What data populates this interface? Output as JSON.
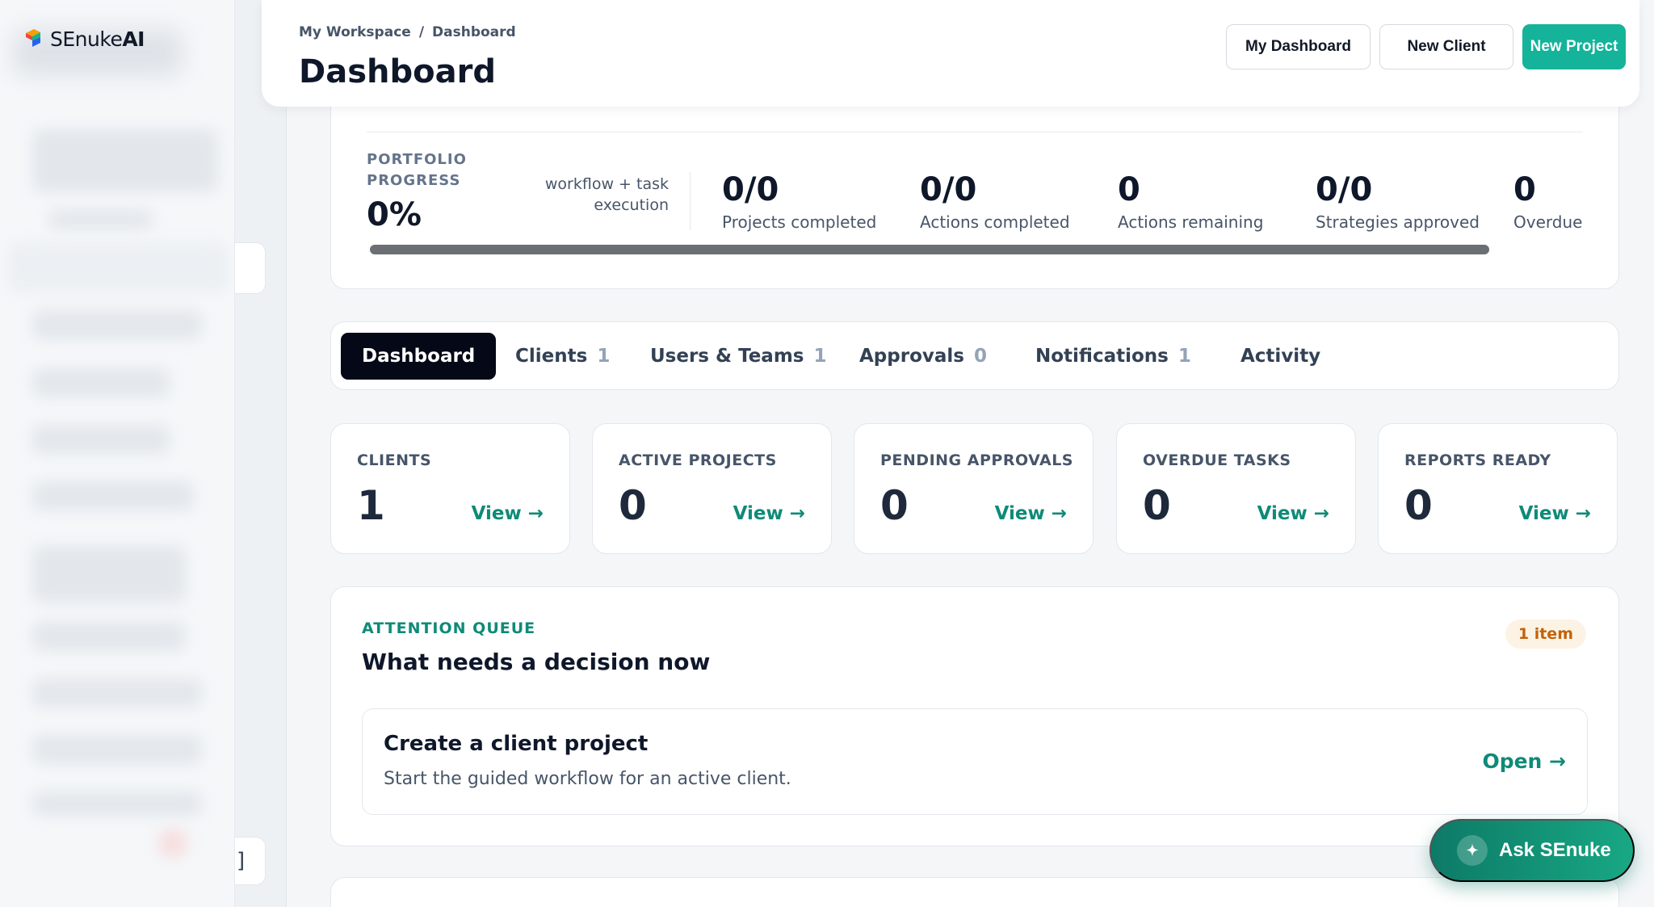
{
  "brand": {
    "name_light": "SEnuke",
    "name_bold": "AI"
  },
  "header": {
    "breadcrumb": [
      "My Workspace",
      "/",
      "Dashboard"
    ],
    "title": "Dashboard",
    "buttons": {
      "my_dashboard": "My Dashboard",
      "new_client": "New Client",
      "new_project": "New Project"
    }
  },
  "portfolio": {
    "label": "PORTFOLIO PROGRESS",
    "value": "0%",
    "progress_fraction": 0,
    "description": "workflow + task execution",
    "stats": [
      {
        "value": "0/0",
        "label": "Projects completed"
      },
      {
        "value": "0/0",
        "label": "Actions completed"
      },
      {
        "value": "0",
        "label": "Actions remaining"
      },
      {
        "value": "0/0",
        "label": "Strategies approved"
      },
      {
        "value": "0",
        "label": "Overdue"
      }
    ]
  },
  "tabs": [
    {
      "label": "Dashboard",
      "count": ""
    },
    {
      "label": "Clients",
      "count": "1"
    },
    {
      "label": "Users & Teams",
      "count": "1"
    },
    {
      "label": "Approvals",
      "count": "0"
    },
    {
      "label": "Notifications",
      "count": "1"
    },
    {
      "label": "Activity",
      "count": ""
    }
  ],
  "metrics": [
    {
      "label": "CLIENTS",
      "value": "1",
      "link": "View →"
    },
    {
      "label": "ACTIVE PROJECTS",
      "value": "0",
      "link": "View →"
    },
    {
      "label": "PENDING APPROVALS",
      "value": "0",
      "link": "View →"
    },
    {
      "label": "OVERDUE TASKS",
      "value": "0",
      "link": "View →"
    },
    {
      "label": "REPORTS READY",
      "value": "0",
      "link": "View →"
    }
  ],
  "attention": {
    "kicker": "ATTENTION QUEUE",
    "title": "What needs a decision now",
    "badge": "1 item",
    "item": {
      "title": "Create a client project",
      "subtitle": "Start the guided workflow for an active client.",
      "link": "Open →"
    }
  },
  "assistant": {
    "label": "Ask SEnuke",
    "icon": "sparkle-icon"
  },
  "colors": {
    "accent": "#14b39a",
    "accent_dark": "#0f8a78",
    "badge_bg": "#fdf3e4",
    "badge_text": "#c2620c",
    "active_tab": "#050816"
  }
}
